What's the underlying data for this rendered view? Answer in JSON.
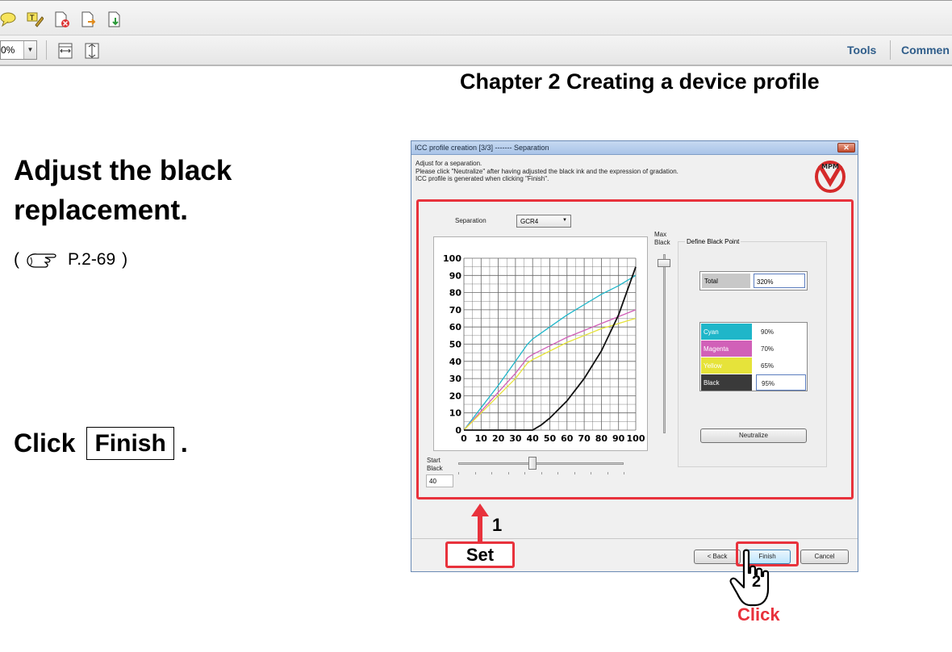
{
  "toolbar": {
    "zoom_value": "0%",
    "tools_label": "Tools",
    "comment_label": "Commen"
  },
  "page": {
    "chapter_title": "Chapter 2 Creating a device profile",
    "step_title": "Adjust the black replacement.",
    "ref_open": "(",
    "ref_page": "P.2-69",
    "ref_close": ")",
    "click_text": "Click",
    "finish_key": "Finish",
    "period": "."
  },
  "dialog": {
    "title": "ICC profile creation  [3/3] ------- Separation",
    "close_glyph": "✕",
    "desc_lines": [
      "Adjust for a separation.",
      "Please click \"Neutralize\" after having adjusted the black ink and the expression of gradation.",
      "ICC profile is generated when clicking \"Finish\"."
    ],
    "logo_text": "MPM",
    "separation_label": "Separation",
    "separation_value": "GCR4",
    "max_black_label_1": "Max",
    "max_black_label_2": "Black",
    "define_black_point_label": "Define Black Point",
    "total": {
      "label": "Total",
      "value": "320%"
    },
    "inks": [
      {
        "label": "Cyan",
        "value": "90%",
        "color": "#1fb6c9"
      },
      {
        "label": "Magenta",
        "value": "70%",
        "color": "#d160b8"
      },
      {
        "label": "Yellow",
        "value": "65%",
        "color": "#e6e33a"
      },
      {
        "label": "Black",
        "value": "95%",
        "color": "#3a3a3a"
      }
    ],
    "neutralize_label": "Neutralize",
    "start_black_label_1": "Start",
    "start_black_label_2": "Black",
    "start_black_value": "40",
    "back_label": "< Back",
    "finish_label": "Finish",
    "cancel_label": "Cancel"
  },
  "annotations": {
    "step1": "1",
    "set_label": "Set",
    "step2": "2",
    "click_label": "Click",
    "highlight_color": "#e8323c"
  },
  "chart_data": {
    "type": "line",
    "x_ticks": [
      0,
      10,
      20,
      30,
      40,
      50,
      60,
      70,
      80,
      90,
      100
    ],
    "y_ticks": [
      0,
      10,
      20,
      30,
      40,
      50,
      60,
      70,
      80,
      90,
      100
    ],
    "xlim": [
      0,
      100
    ],
    "ylim": [
      0,
      100
    ],
    "grid": true,
    "series": [
      {
        "name": "Cyan",
        "color": "#1fb6c9",
        "x": [
          0,
          10,
          20,
          30,
          37,
          40,
          50,
          60,
          70,
          80,
          90,
          100
        ],
        "y": [
          0,
          13,
          26,
          40,
          50,
          53,
          60,
          67,
          73,
          79,
          84,
          90
        ]
      },
      {
        "name": "Magenta",
        "color": "#d160b8",
        "x": [
          0,
          10,
          20,
          30,
          37,
          40,
          50,
          60,
          70,
          80,
          90,
          100
        ],
        "y": [
          0,
          11,
          22,
          33,
          42,
          44,
          49,
          54,
          58,
          62,
          66,
          70
        ]
      },
      {
        "name": "Yellow",
        "color": "#e6e33a",
        "x": [
          0,
          10,
          20,
          30,
          37,
          40,
          50,
          60,
          70,
          80,
          90,
          100
        ],
        "y": [
          0,
          10,
          20,
          30,
          39,
          41,
          46,
          51,
          55,
          59,
          62,
          65
        ]
      },
      {
        "name": "Black",
        "color": "#111111",
        "x": [
          0,
          40,
          45,
          50,
          60,
          70,
          80,
          90,
          100
        ],
        "y": [
          0,
          0,
          3,
          7,
          17,
          30,
          46,
          67,
          95
        ]
      }
    ]
  }
}
